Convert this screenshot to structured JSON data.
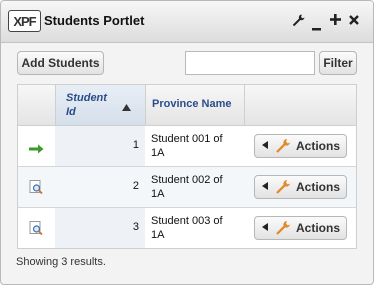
{
  "portlet": {
    "logo": "XPF",
    "title": "Students Portlet",
    "controls": [
      "wrench-icon",
      "minimize-icon",
      "maximize-icon",
      "close-icon"
    ]
  },
  "toolbar": {
    "add_label": "Add Students",
    "filter_value": "",
    "filter_label": "Filter"
  },
  "grid": {
    "columns": [
      {
        "label": "Student Id",
        "sorted": "ascending"
      },
      {
        "label": "Province Name"
      }
    ],
    "rows": [
      {
        "icon": "arrow-right-icon",
        "id": "1",
        "name": "Student 001 of 1A",
        "action_label": "Actions"
      },
      {
        "icon": "magnifier-doc-icon",
        "id": "2",
        "name": "Student 002 of 1A",
        "action_label": "Actions"
      },
      {
        "icon": "magnifier-doc-icon",
        "id": "3",
        "name": "Student 003 of 1A",
        "action_label": "Actions"
      }
    ]
  },
  "status": "Showing 3 results.",
  "colors": {
    "header_text": "#2a4d8a",
    "arrow_green": "#3a9a2a",
    "wrench_orange": "#e08a2a"
  }
}
